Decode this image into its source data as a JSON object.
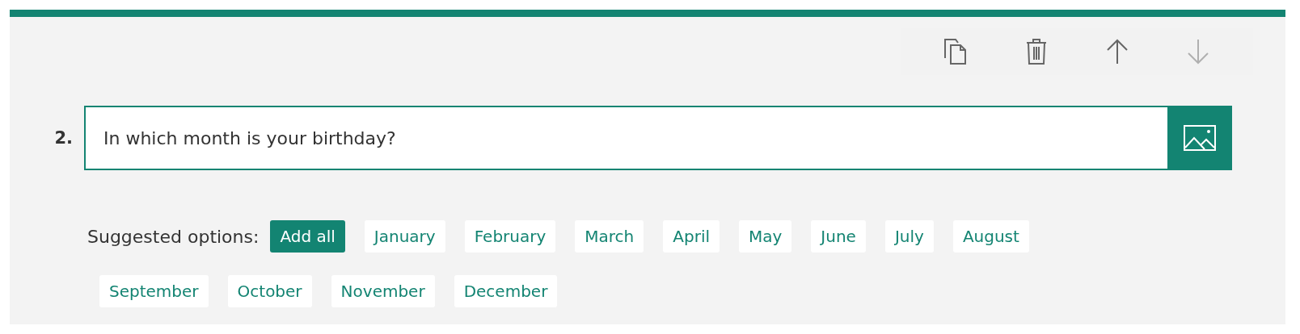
{
  "toolbar": [
    {
      "kind": "copy",
      "disabled": false
    },
    {
      "kind": "delete",
      "disabled": false
    },
    {
      "kind": "up",
      "disabled": false
    },
    {
      "kind": "down",
      "disabled": true
    }
  ],
  "question": {
    "number": "2.",
    "value": "In which month is your birthday?"
  },
  "suggestions": {
    "label": "Suggested options:",
    "options": [
      {
        "kind": "add-all",
        "text": "Add all"
      },
      {
        "kind": "option",
        "text": "January"
      },
      {
        "kind": "option",
        "text": "February"
      },
      {
        "kind": "option",
        "text": "March"
      },
      {
        "kind": "option",
        "text": "April"
      },
      {
        "kind": "option",
        "text": "May"
      },
      {
        "kind": "option",
        "text": "June"
      },
      {
        "kind": "option",
        "text": "July"
      },
      {
        "kind": "option",
        "text": "August"
      },
      {
        "kind": "option",
        "text": "September"
      },
      {
        "kind": "option",
        "text": "October"
      },
      {
        "kind": "option",
        "text": "November"
      },
      {
        "kind": "option",
        "text": "December"
      }
    ]
  }
}
